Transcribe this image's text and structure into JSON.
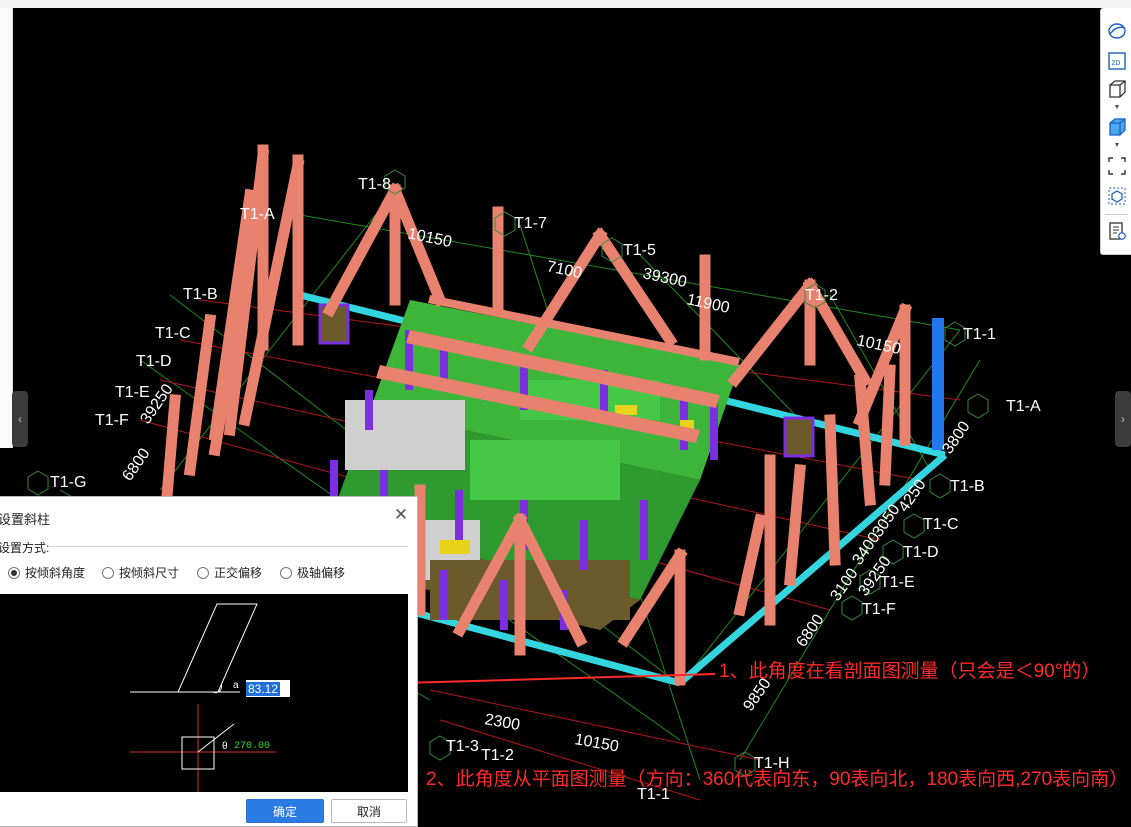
{
  "scene": {
    "axis_labels_top": [
      "T1-8",
      "T1-7",
      "T1-5",
      "T1-2",
      "T1-1"
    ],
    "axis_labels_left": [
      "T1-A",
      "T1-B",
      "T1-C",
      "T1-D",
      "T1-E",
      "T1-F",
      "T1-G"
    ],
    "axis_labels_right": [
      "T1-A",
      "T1-B",
      "T1-C",
      "T1-D",
      "T1-E",
      "T1-F"
    ],
    "axis_labels_bottom": [
      "T1-3",
      "T1-2",
      "T1-1",
      "T1-H"
    ],
    "dimensions": [
      "10150",
      "7100",
      "39300",
      "11900",
      "10150",
      "39250",
      "6800",
      "2300",
      "10150",
      "9850",
      "6800",
      "39250",
      "3100",
      "3400",
      "3050",
      "4250",
      "3800"
    ]
  },
  "toolbar": {
    "items": [
      "orbit-icon",
      "2d-view-icon",
      "3d-wireframe-icon",
      "3d-solid-icon",
      "fit-view-icon",
      "isolate-icon",
      "properties-view-icon"
    ]
  },
  "dialog": {
    "title": "设置斜柱",
    "mode_label": "设置方式:",
    "options": [
      "按倾斜角度",
      "按倾斜尺寸",
      "正交偏移",
      "极轴偏移"
    ],
    "selected_option": "按倾斜角度",
    "alpha_symbol": "a",
    "alpha_value": "83.12",
    "theta_symbol": "θ",
    "theta_value": "270.00",
    "ok_label": "确定",
    "cancel_label": "取消"
  },
  "annotations": {
    "note_1": "1、此角度在看剖面图测量（只会是＜90°的）",
    "note_2": "2、此角度从平面图测量（方向：360代表向东，90表向北，180表向西,270表向南）"
  },
  "colors": {
    "background": "#000000",
    "truss": "#e8826e",
    "slab_edge": "#33d6de",
    "wall_green": "#3db43a",
    "wall_purple": "#7b2fe0",
    "wall_gray": "#cfcfcf",
    "annotation_red": "#ff2a2a",
    "accent_blue": "#2a7be4"
  }
}
